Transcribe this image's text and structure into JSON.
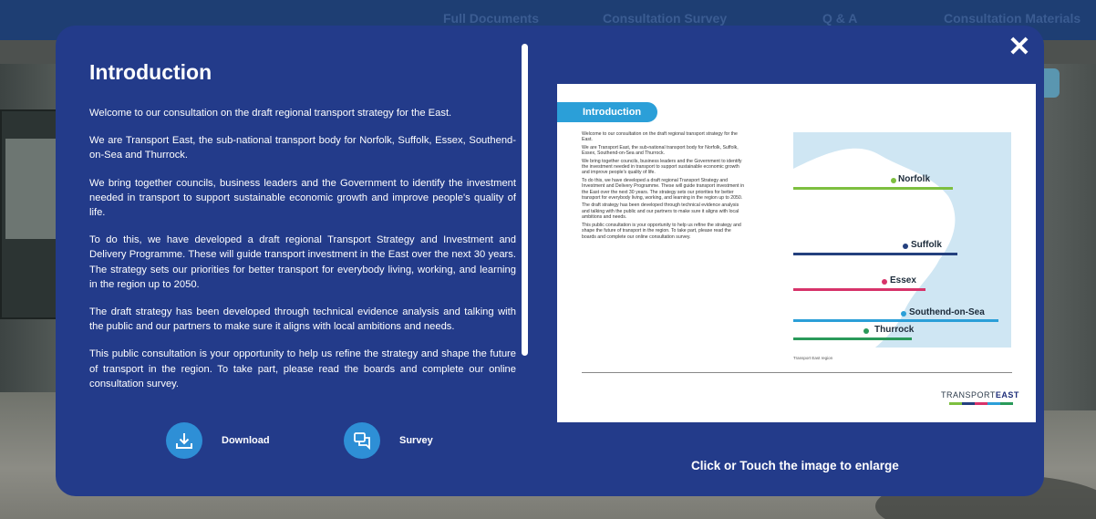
{
  "nav": {
    "items": [
      "Full Documents",
      "Consultation Survey",
      "Q & A",
      "Consultation Materials"
    ]
  },
  "modal": {
    "close_label": "✕",
    "title": "Introduction",
    "paragraphs": [
      "Welcome to our consultation on the draft regional transport strategy for the East.",
      "We are Transport East, the sub-national transport body for Norfolk, Suffolk, Essex, Southend-on-Sea and Thurrock.",
      "We bring together councils, business leaders and the Government to identify the investment needed in transport to support sustainable economic growth and improve people's quality of life.",
      "To do this, we have developed a draft regional Transport Strategy and Investment and Delivery Programme. These will guide transport investment in the East over the next 30 years. The strategy sets our priorities for better transport for everybody living, working, and learning in the region up to 2050.",
      "The draft strategy has been developed through technical evidence analysis and talking with the public and our partners to make sure it aligns with local ambitions and needs.",
      "This public consultation is your opportunity to help us refine the strategy and shape the future of transport in the region. To take part, please read the boards and complete our online consultation survey."
    ],
    "actions": {
      "download": {
        "label": "Download",
        "icon": "download-icon"
      },
      "survey": {
        "label": "Survey",
        "icon": "chat-icon"
      }
    },
    "enlarge_hint": "Click or Touch the  image to enlarge"
  },
  "preview": {
    "tag": "Introduction",
    "text": [
      "Welcome to our consultation on the draft regional transport strategy for the East.",
      "We are Transport East, the sub-national transport body for Norfolk, Suffolk, Essex, Southend-on-Sea and Thurrock.",
      "We bring together councils, business leaders and the Government to identify the investment needed in transport to support sustainable economic growth and improve people's quality of life.",
      "To do this, we have developed a draft regional Transport Strategy and Investment and Delivery Programme. These will guide transport investment in the East over the next 30 years. The strategy sets our priorities for better transport for everybody living, working, and learning in the region up to 2050.",
      "The draft strategy has been developed through technical evidence analysis and talking with the public and our partners to make sure it aligns with local ambitions and needs.",
      "This public consultation is your opportunity to help us refine the strategy and shape the future of transport in the region. To take part, please read the boards and complete our online consultation survey."
    ],
    "regions": [
      {
        "name": "Norfolk",
        "color": "#7dbf3f"
      },
      {
        "name": "Suffolk",
        "color": "#24407e"
      },
      {
        "name": "Essex",
        "color": "#d7336a"
      },
      {
        "name": "Southend-on-Sea",
        "color": "#2b9fd8"
      },
      {
        "name": "Thurrock",
        "color": "#2a9a5a"
      }
    ],
    "caption": "Transport East region",
    "brand": {
      "prefix": "TRANSPORT",
      "suffix": "EAST"
    }
  },
  "colors": {
    "modal_bg": "#233b8a",
    "accent": "#2e8fd6",
    "nav_bg": "#1e3e73"
  }
}
